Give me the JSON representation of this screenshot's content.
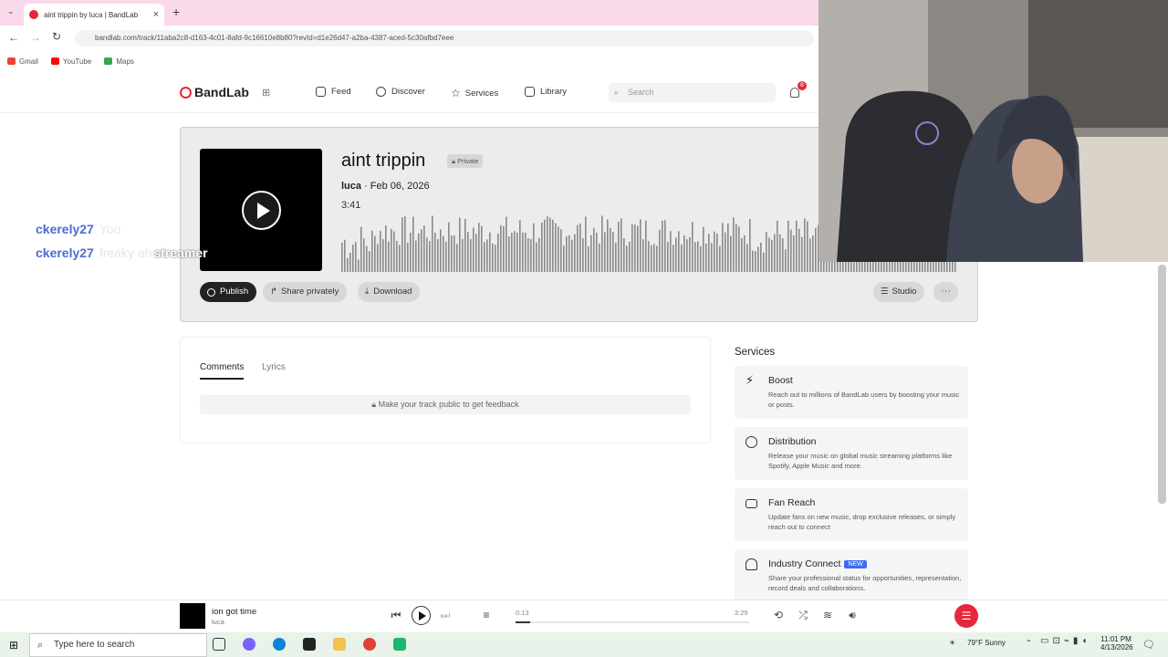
{
  "browser": {
    "tab_title": "aint trippin by luca | BandLab",
    "url": "bandlab.com/track/11aba2c8-d163-4c01-8afd-9c16610e8b80?revId=d1e26d47-a2ba-4387-aced-5c30afbd7eee",
    "bookmarks": [
      "Gmail",
      "YouTube",
      "Maps"
    ]
  },
  "nav": {
    "brand": "BandLab",
    "items": [
      "Feed",
      "Discover",
      "Services",
      "Library"
    ],
    "search_placeholder": "Search",
    "notification_count": "8"
  },
  "track": {
    "title": "aint trippin",
    "visibility": "Private",
    "artist": "luca",
    "date": " · Feb 06, 2026",
    "duration": "3:41",
    "buttons": {
      "publish": "Publish",
      "share": "Share privately",
      "download": "Download",
      "studio": "Studio",
      "more": "···"
    }
  },
  "chat": [
    {
      "user": "ckerely27",
      "message": "Yoo"
    },
    {
      "user": "ckerely27",
      "message": "freaky ah",
      "overlay": "streamer"
    }
  ],
  "comments": {
    "tabs": [
      "Comments",
      "Lyrics"
    ],
    "feedback_notice": "Make your track public to get feedback"
  },
  "services": {
    "heading": "Services",
    "items": [
      {
        "name": "Boost",
        "desc": "Reach out to millions of BandLab users by boosting your music or posts."
      },
      {
        "name": "Distribution",
        "desc": "Release your music on global music streaming platforms like Spotify, Apple Music and more."
      },
      {
        "name": "Fan Reach",
        "desc": "Update fans on new music, drop exclusive releases, or simply reach out to connect"
      },
      {
        "name": "Industry Connect",
        "badge": "NEW",
        "desc": "Share your professional status for opportunities, representation, record deals and collaborations."
      }
    ]
  },
  "player": {
    "title": "ion got time",
    "artist": "luca",
    "elapsed": "0:13",
    "total": "3:29",
    "progress": 0.062
  },
  "taskbar": {
    "search_placeholder": "Type here to search",
    "weather": "79°F  Sunny",
    "time": "11:01 PM",
    "date": "4/13/2026"
  },
  "colors": {
    "brand": "#e5283b",
    "chat_user": "#4d6bd6",
    "taskbar": "#e9f3e9"
  }
}
